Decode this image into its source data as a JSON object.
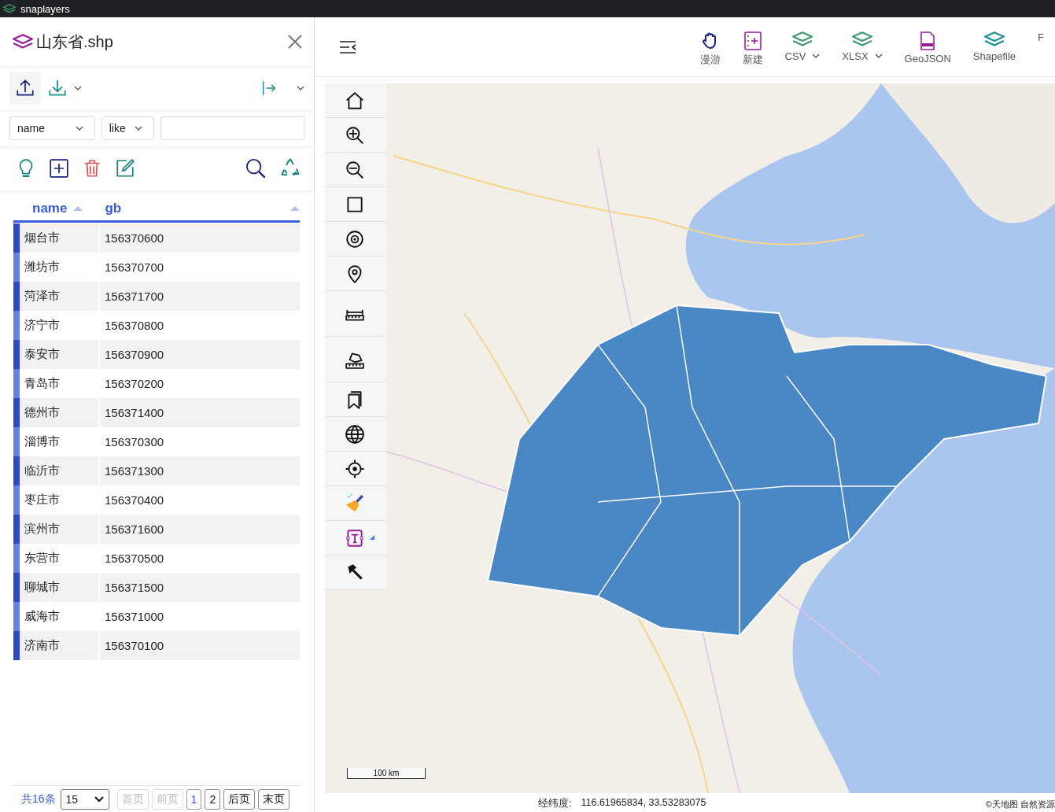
{
  "app": {
    "title": "snaplayers"
  },
  "layer_panel": {
    "title": "山东省.shp",
    "filter": {
      "field": "name",
      "operator": "like"
    },
    "table": {
      "columns": [
        "name",
        "gb"
      ],
      "rows": [
        {
          "name": "烟台市",
          "gb": "156370600"
        },
        {
          "name": "潍坊市",
          "gb": "156370700"
        },
        {
          "name": "菏泽市",
          "gb": "156371700"
        },
        {
          "name": "济宁市",
          "gb": "156370800"
        },
        {
          "name": "泰安市",
          "gb": "156370900"
        },
        {
          "name": "青岛市",
          "gb": "156370200"
        },
        {
          "name": "德州市",
          "gb": "156371400"
        },
        {
          "name": "淄博市",
          "gb": "156370300"
        },
        {
          "name": "临沂市",
          "gb": "156371300"
        },
        {
          "name": "枣庄市",
          "gb": "156370400"
        },
        {
          "name": "滨州市",
          "gb": "156371600"
        },
        {
          "name": "东营市",
          "gb": "156370500"
        },
        {
          "name": "聊城市",
          "gb": "156371500"
        },
        {
          "name": "威海市",
          "gb": "156371000"
        },
        {
          "name": "济南市",
          "gb": "156370100"
        }
      ]
    },
    "pagination": {
      "total": "共16条",
      "page_size": "15",
      "nav_before": [
        {
          "label": "首页",
          "disabled": true
        },
        {
          "label": "前页",
          "disabled": true
        }
      ],
      "pages": [
        {
          "label": "1",
          "selected": true
        },
        {
          "label": "2",
          "selected": false
        }
      ],
      "nav_after": [
        {
          "label": "后页",
          "disabled": false
        },
        {
          "label": "末页",
          "disabled": false
        }
      ]
    }
  },
  "toolbar": {
    "items": [
      {
        "label": "漫游",
        "dropdown": false
      },
      {
        "label": "新建",
        "dropdown": false
      },
      {
        "label": "CSV",
        "dropdown": true
      },
      {
        "label": "XLSX",
        "dropdown": true
      },
      {
        "label": "GeoJSON",
        "dropdown": false
      },
      {
        "label": "Shapefile",
        "dropdown": false
      },
      {
        "label": "F",
        "dropdown": false
      }
    ]
  },
  "map": {
    "scale": "100 km",
    "coordinates": {
      "label": "经纬度:",
      "value": "116.61965834, 33.53283075"
    },
    "attribution": "©天地图 自然资源"
  }
}
